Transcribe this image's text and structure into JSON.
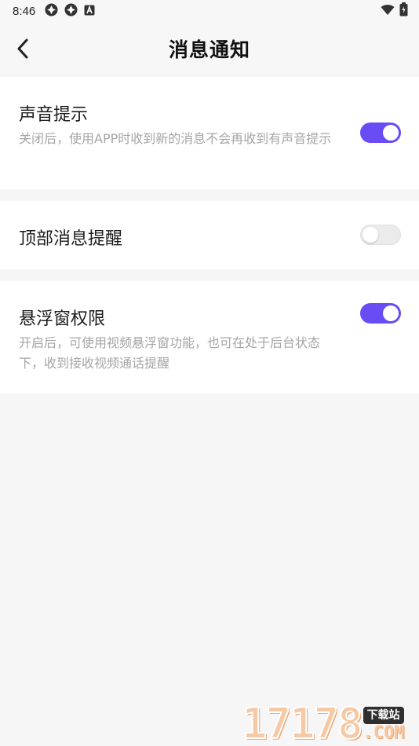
{
  "status_bar": {
    "time": "8:46",
    "left_icons": [
      "app-notification-icon",
      "app-notification-icon",
      "keyboard-a-icon"
    ],
    "right_icons": [
      "wifi-icon",
      "battery-icon"
    ]
  },
  "header": {
    "title": "消息通知",
    "back_icon": "back-arrow-icon"
  },
  "settings": {
    "sound": {
      "title": "声音提示",
      "description": "关闭后，使用APP时收到新的消息不会再收到有声音提示",
      "enabled": true
    },
    "top_banner": {
      "title": "顶部消息提醒",
      "enabled": false
    },
    "floating_window": {
      "title": "悬浮窗权限",
      "description": "开启后，可使用视频悬浮窗功能，也可在处于后台状态下，收到接收视频通话提醒",
      "enabled": true
    }
  },
  "watermark": {
    "digits": "17178",
    "badge": "下载站",
    "domain": ".COM"
  },
  "colors": {
    "toggle_on": "#6a4cf5",
    "toggle_off": "#ebebeb",
    "page_background": "#f6f6f6",
    "card_background": "#ffffff",
    "description_text": "#a5a5a5"
  }
}
